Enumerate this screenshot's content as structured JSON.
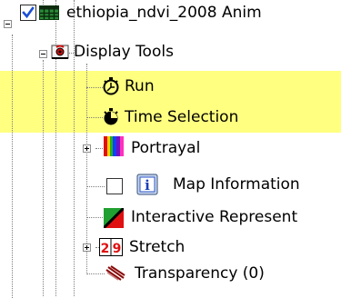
{
  "tree": {
    "root": {
      "label": "ethiopia_ndvi_2008 Anim",
      "checked": true,
      "icon": "raster-grid-icon"
    },
    "display_tools": {
      "label": "Display Tools",
      "icon": "display-tools-icon"
    },
    "items": [
      {
        "id": "run",
        "label": "Run",
        "icon": "stopwatch-icon",
        "highlighted": true
      },
      {
        "id": "time-selection",
        "label": "Time Selection",
        "icon": "stopwatch-filled-icon",
        "highlighted": true
      },
      {
        "id": "portrayal",
        "label": "Portrayal",
        "icon": "color-bars-icon",
        "expandable": true
      },
      {
        "id": "map-information",
        "label": "Map Information",
        "icon": "info-icon",
        "checkbox": true,
        "checked": false
      },
      {
        "id": "interactive-representation",
        "label": "Interactive Represent",
        "icon": "triangle-swatch-icon"
      },
      {
        "id": "stretch",
        "label": "Stretch",
        "icon": "stretch-icon",
        "expandable": true
      },
      {
        "id": "transparency",
        "label": "Transparency (0)",
        "icon": "transparency-icon"
      }
    ],
    "colors": {
      "highlight": "#ffff80",
      "check": "#1a4fd6",
      "tree_line": "#7f7f7f"
    }
  }
}
